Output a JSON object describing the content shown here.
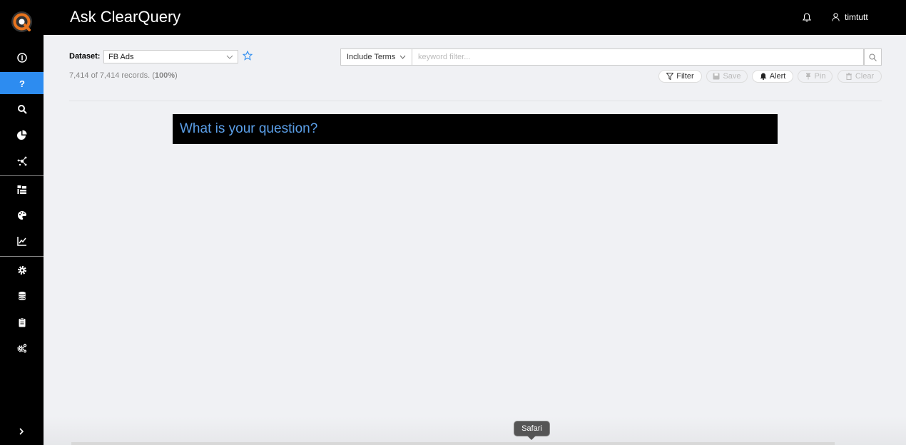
{
  "header": {
    "title": "Ask ClearQuery",
    "user": "timtutt"
  },
  "sidebar": {
    "items": [
      {
        "icon": "info-icon"
      },
      {
        "icon": "question-icon",
        "active": true
      },
      {
        "icon": "search-icon"
      },
      {
        "icon": "pie-chart-icon"
      },
      {
        "icon": "network-icon"
      },
      {
        "icon": "hierarchy-icon"
      },
      {
        "icon": "palette-icon"
      },
      {
        "icon": "trend-chart-icon"
      },
      {
        "icon": "gear-icon"
      },
      {
        "icon": "database-icon"
      },
      {
        "icon": "clipboard-icon"
      },
      {
        "icon": "gears-icon"
      }
    ],
    "expand_icon": "chevron-right-icon"
  },
  "toolbar": {
    "dataset_label": "Dataset:",
    "dataset_value": "FB Ads",
    "records_prefix": "7,414 of 7,414 records. (",
    "records_pct": "100%",
    "records_suffix": ")",
    "terms_mode": "Include Terms",
    "keyword_placeholder": "keyword filter...",
    "filter_label": "Filter",
    "save_label": "Save",
    "alert_label": "Alert",
    "pin_label": "Pin",
    "clear_label": "Clear"
  },
  "main": {
    "question_placeholder": "What is your question?"
  },
  "dock": {
    "tooltip": "Safari"
  },
  "colors": {
    "accent": "#2d8cf0",
    "question_text": "#5b9fe8",
    "sidebar_bg": "#000000",
    "page_bg": "#f0f1f4"
  }
}
